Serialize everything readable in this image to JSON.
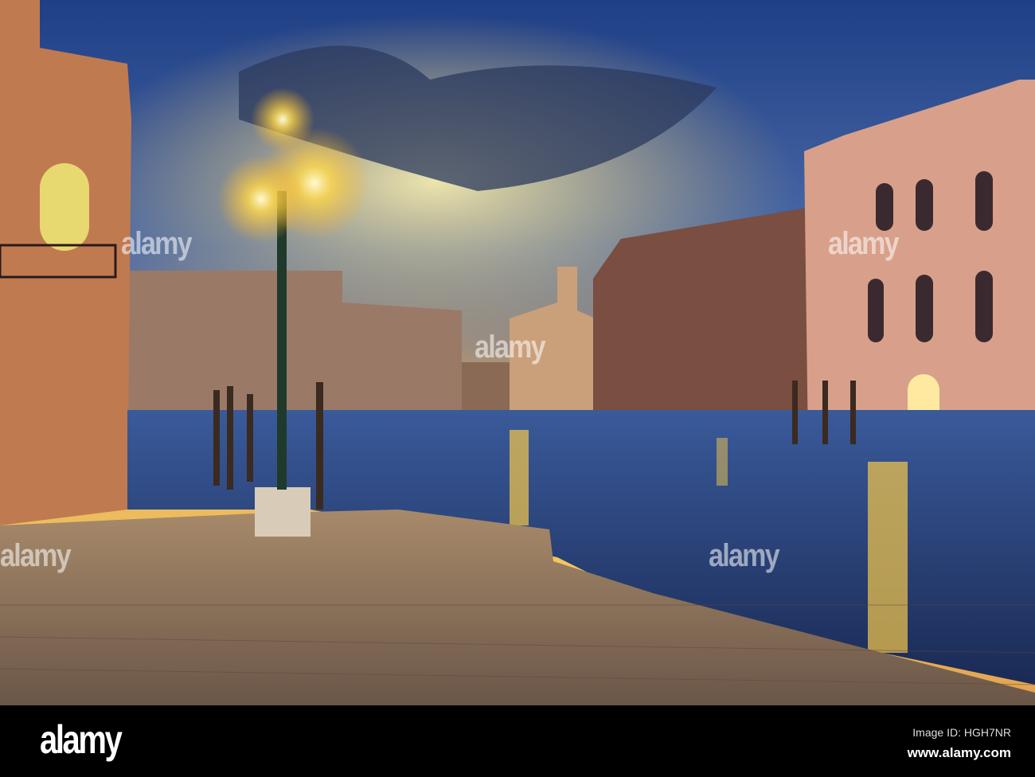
{
  "photo": {
    "subject": "Grand Canal in Venice at sunset with street lamp",
    "watermark": "alamy"
  },
  "footer": {
    "logo": "alamy",
    "image_id": "Image ID: HGH7NR",
    "website": "www.alamy.com"
  },
  "colors": {
    "sky_top": "#2a4a8a",
    "sky_glow": "#f7c85a",
    "water": "#2a4f8a",
    "lamp": "#fff3a0"
  }
}
